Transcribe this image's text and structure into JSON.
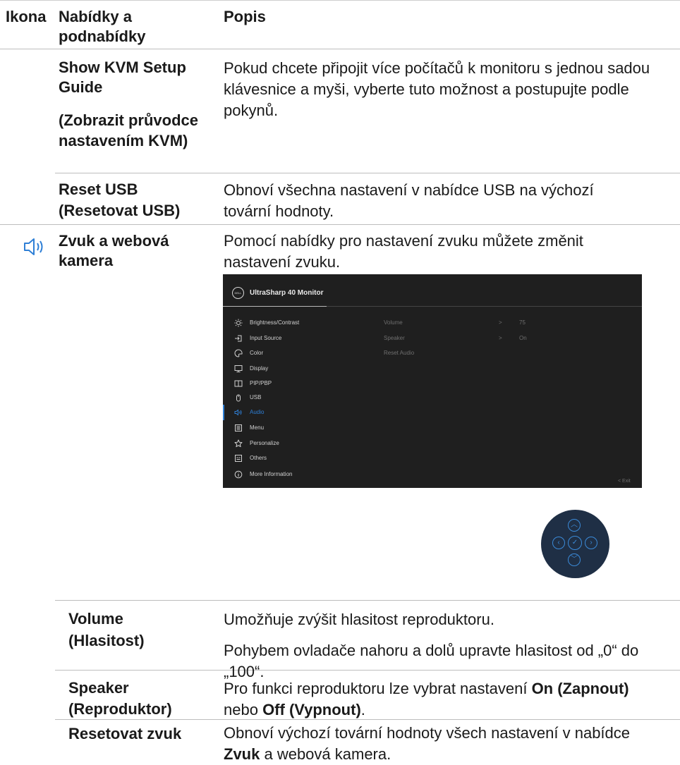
{
  "header": {
    "icon_col": "Ikona",
    "menu_col": "Nabídky a podnabídky",
    "desc_col": "Popis"
  },
  "rows": {
    "kvm": {
      "name": "Show KVM Setup Guide",
      "name_cs": "(Zobrazit průvodce nastavením KVM)",
      "desc": "Pokud chcete připojit více počítačů k monitoru s jednou sadou klávesnice a myši, vyberte tuto možnost a postupujte podle pokynů."
    },
    "reset_usb": {
      "name": "Reset USB",
      "name_cs": "(Resetovat USB)",
      "desc": "Obnoví všechna nastavení v nabídce USB na výchozí tovární hodnoty."
    },
    "audio": {
      "icon": "speaker-icon",
      "name": "Zvuk a webová kamera",
      "desc": "Pomocí nabídky pro nastavení zvuku můžete změnit nastavení zvuku."
    },
    "volume": {
      "name": "Volume",
      "name_cs": "(Hlasitost)",
      "desc1": "Umožňuje zvýšit hlasitost reproduktoru.",
      "desc2": "Pohybem ovladače nahoru a dolů upravte hlasitost od „0“ do „100“."
    },
    "speaker": {
      "name": "Speaker",
      "name_cs": "(Reproduktor)",
      "desc_a": "Pro funkci reproduktoru lze vybrat nastavení ",
      "desc_on": "On (Zapnout)",
      "desc_b": " nebo ",
      "desc_off": "Off (Vypnout)",
      "desc_c": "."
    },
    "reset_audio": {
      "name": "Resetovat zvuk",
      "desc_a": "Obnoví výchozí tovární hodnoty všech nastavení v nabídce ",
      "desc_bold": "Zvuk",
      "desc_b": " a webová kamera."
    }
  },
  "osd": {
    "logo": "DELL",
    "title": "UltraSharp 40 Monitor",
    "menu": [
      {
        "label": "Brightness/Contrast",
        "icon": "brightness-icon"
      },
      {
        "label": "Input Source",
        "icon": "input-source-icon"
      },
      {
        "label": "Color",
        "icon": "color-icon"
      },
      {
        "label": "Display",
        "icon": "display-icon"
      },
      {
        "label": "PIP/PBP",
        "icon": "pip-pbp-icon"
      },
      {
        "label": "USB",
        "icon": "usb-icon"
      },
      {
        "label": "Audio",
        "icon": "audio-icon",
        "active": true
      },
      {
        "label": "Menu",
        "icon": "menu-icon"
      },
      {
        "label": "Personalize",
        "icon": "star-icon"
      },
      {
        "label": "Others",
        "icon": "others-icon"
      },
      {
        "label": "More Information",
        "icon": "info-icon"
      }
    ],
    "submenu": [
      {
        "label": "Volume",
        "arrow": ">",
        "value": "75"
      },
      {
        "label": "Speaker",
        "arrow": ">",
        "value": "On"
      },
      {
        "label": "Reset Audio"
      }
    ],
    "exit": "< Exit",
    "accent": "#2e7fd6"
  }
}
